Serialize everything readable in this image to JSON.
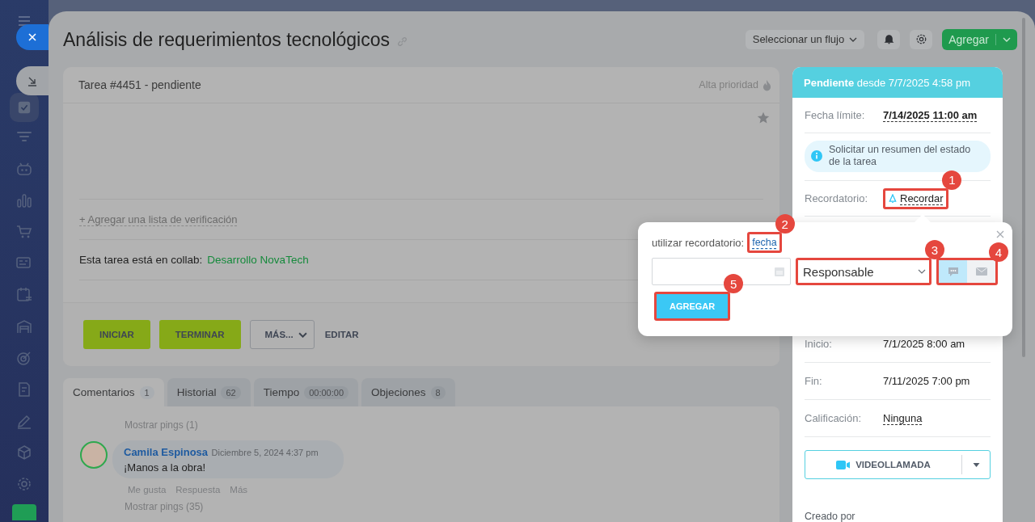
{
  "title": "Análisis de requerimientos tecnológicos",
  "toolbar": {
    "flow_select": "Seleccionar un flujo",
    "add_button": "Agregar"
  },
  "task": {
    "heading": "Tarea #4451 - pendiente",
    "priority": "Alta prioridad",
    "checklist_link": "+ Agregar una lista de verificación",
    "collab_label": "Esta tarea está en collab:",
    "collab_link": "Desarrollo NovaTech"
  },
  "actions": [
    {
      "label": "INICIAR",
      "kind": "primary"
    },
    {
      "label": "TERMINAR",
      "kind": "primary"
    },
    {
      "label": "MÁS...",
      "kind": "menu"
    },
    {
      "label": "EDITAR",
      "kind": "text"
    }
  ],
  "tabs": [
    {
      "label": "Comentarios",
      "count": "1",
      "selected": true
    },
    {
      "label": "Historial",
      "count": "62",
      "selected": false
    },
    {
      "label": "Tiempo",
      "count": "00:00:00",
      "selected": false
    },
    {
      "label": "Objeciones",
      "count": "8",
      "selected": false
    }
  ],
  "comments_feed": {
    "pings_top": "Mostrar pings (1)",
    "comment": {
      "author": "Camila Espinosa",
      "date": "Diciembre 5, 2024 4:37 pm",
      "text": "¡Manos a la obra!",
      "actions": [
        "Me gusta",
        "Respuesta",
        "Más"
      ]
    },
    "pings_bottom": "Mostrar pings (35)"
  },
  "status_panel": {
    "status": "Pendiente",
    "since": "desde 7/7/2025 4:58 pm",
    "deadline_label": "Fecha límite:",
    "deadline": "7/14/2025 11:00 am",
    "summary_hint": "Solicitar un resumen del estado de la tarea",
    "reminder_label": "Recordatorio:",
    "reminder_link": "Recordar",
    "reminder_callout": "1",
    "fields": [
      {
        "label": "Inicio:",
        "value": "7/1/2025 8:00 am",
        "kind": "plain"
      },
      {
        "label": "Fin:",
        "value": "7/11/2025 7:00 pm",
        "kind": "plain"
      },
      {
        "label": "Calificación:",
        "value": "Ninguna",
        "kind": "link"
      }
    ],
    "video_call": "VIDEOLLAMADA",
    "created_by": "Creado por"
  },
  "reminder_popup": {
    "label": "utilizar recordatorio:",
    "mode_link": "fecha",
    "mode_callout": "2",
    "recipient": "Responsable",
    "recipient_callout": "3",
    "channels": [
      {
        "kind": "chat",
        "selected": true
      },
      {
        "kind": "mail",
        "selected": false
      }
    ],
    "channels_callout": "4",
    "submit": "AGREGAR",
    "submit_callout": "5"
  }
}
